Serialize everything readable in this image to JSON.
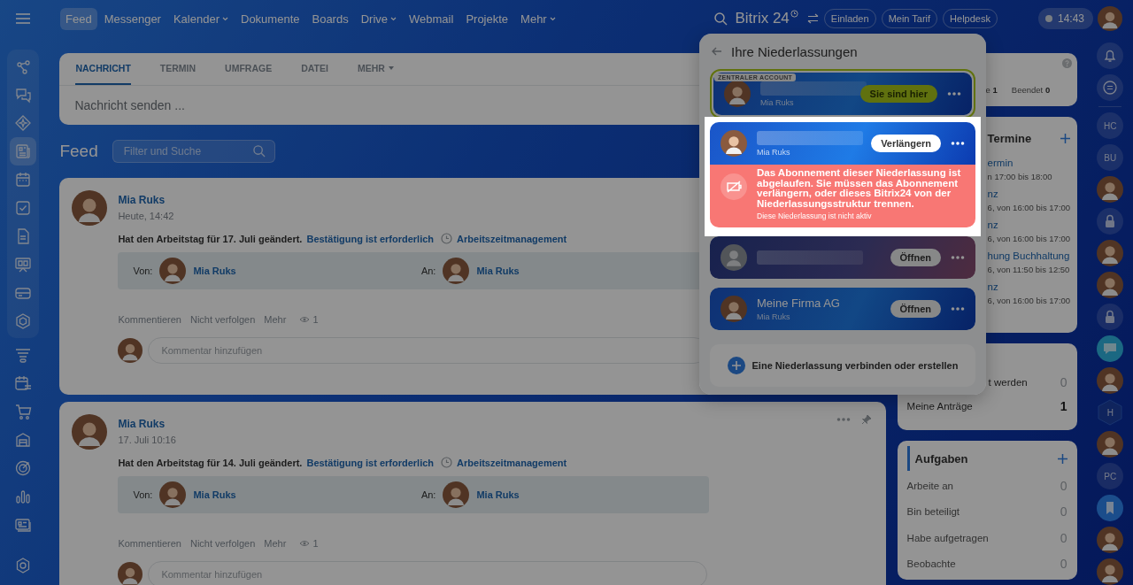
{
  "topbar": {
    "nav": [
      {
        "label": "Feed",
        "selected": true,
        "dropdown": false
      },
      {
        "label": "Messenger",
        "selected": false,
        "dropdown": false
      },
      {
        "label": "Kalender",
        "selected": false,
        "dropdown": true
      },
      {
        "label": "Dokumente",
        "selected": false,
        "dropdown": false
      },
      {
        "label": "Boards",
        "selected": false,
        "dropdown": false
      },
      {
        "label": "Drive",
        "selected": false,
        "dropdown": true
      },
      {
        "label": "Webmail",
        "selected": false,
        "dropdown": false
      },
      {
        "label": "Projekte",
        "selected": false,
        "dropdown": false
      },
      {
        "label": "Mehr",
        "selected": false,
        "dropdown": true
      }
    ],
    "logo": "Bitrix 24",
    "buttons": [
      "Einladen",
      "Mein Tarif",
      "Helpdesk"
    ],
    "time": "14:43"
  },
  "sidebar": {
    "items": [
      {
        "selected": false
      },
      {
        "selected": false
      },
      {
        "selected": false
      },
      {
        "selected": true
      },
      {
        "selected": false
      },
      {
        "selected": false
      },
      {
        "selected": false
      },
      {
        "selected": false
      },
      {
        "selected": false
      },
      {
        "selected": false
      },
      {
        "selected": false
      },
      {
        "selected": false
      },
      {
        "selected": false
      },
      {
        "selected": false
      },
      {
        "selected": false
      },
      {
        "selected": false
      },
      {
        "selected": false
      }
    ]
  },
  "composer": {
    "tabs": [
      {
        "label": "NACHRICHT",
        "selected": true,
        "dropdown": false
      },
      {
        "label": "TERMIN",
        "selected": false,
        "dropdown": false
      },
      {
        "label": "UMFRAGE",
        "selected": false,
        "dropdown": false
      },
      {
        "label": "DATEI",
        "selected": false,
        "dropdown": false
      },
      {
        "label": "MEHR",
        "selected": false,
        "dropdown": true
      }
    ],
    "placeholder": "Nachricht senden ..."
  },
  "feed": {
    "title": "Feed",
    "search_placeholder": "Filter und Suche",
    "posts": [
      {
        "author": "Mia Ruks",
        "time": "Heute, 14:42",
        "text": "Hat den Arbeitstag für 17. Juli geändert.",
        "status_link": "Bestätigung ist erforderlich",
        "module_link": "Arbeitszeitmanagement",
        "from_label": "Von:",
        "from": "Mia Ruks",
        "to_label": "An:",
        "to": "Mia Ruks",
        "actions": [
          "Kommentieren",
          "Nicht verfolgen",
          "Mehr"
        ],
        "views": "1",
        "comment_placeholder": "Kommentar hinzufügen"
      },
      {
        "author": "Mia Ruks",
        "time": "17. Juli 10:16",
        "text": "Hat den Arbeitstag für 14. Juli geändert.",
        "status_link": "Bestätigung ist erforderlich",
        "module_link": "Arbeitszeitmanagement",
        "from_label": "Von:",
        "from": "Mia Ruks",
        "to_label": "An:",
        "to": "Mia Ruks",
        "actions": [
          "Kommentieren",
          "Nicht verfolgen",
          "Mehr"
        ],
        "views": "1",
        "comment_placeholder": "Kommentar hinzufügen",
        "menu_visible": true
      }
    ]
  },
  "popup": {
    "title": "Ihre Niederlassungen",
    "accounts": [
      {
        "kind": "central",
        "badge": "ZENTRALER ACCOUNT",
        "owner": "Mia Ruks",
        "button": "Sie sind hier",
        "highlighted": false
      },
      {
        "kind": "expired",
        "owner": "Mia Ruks",
        "button": "Verlängern",
        "highlighted": true,
        "message": "Das Abonnement dieser Niederlassung ist abgelaufen. Sie müssen das Abonnement verlängern, oder dieses Bitrix24 von der Niederlassungsstruktur trennen.",
        "note": "Diese Niederlassung ist nicht aktiv"
      },
      {
        "kind": "inactive",
        "button": "Öffnen",
        "highlighted": false
      },
      {
        "kind": "open",
        "name": "Meine Firma AG",
        "owner": "Mia Ruks",
        "button": "Öffnen",
        "highlighted": false
      }
    ],
    "footer": "Eine Niederlassung verbinden oder erstellen"
  },
  "right": {
    "stats": [
      {
        "label": "e",
        "count": "1"
      },
      {
        "label": "Beendet",
        "count": "0"
      }
    ],
    "events": {
      "title": "Termine",
      "items": [
        {
          "title": "ermin",
          "time": "n 17:00 bis 18:00"
        },
        {
          "title": "nz",
          "time": "6, von 16:00 bis 17:00"
        },
        {
          "title": "nz",
          "time": "6, von 16:00 bis 17:00"
        },
        {
          "title": "hung Buchhaltung",
          "time": "6, von 11:50 bis 12:50"
        },
        {
          "title": "nz",
          "time": "6, von 16:00 bis 17:00"
        }
      ]
    },
    "requests": [
      {
        "kind": "clipped",
        "label": "t werden",
        "count": "0",
        "emphasis": false
      },
      {
        "kind": "row",
        "label": "Meine Anträge",
        "count": "1",
        "emphasis": true
      }
    ],
    "tasks": {
      "title": "Aufgaben",
      "items": [
        {
          "label": "Arbeite an",
          "count": "0"
        },
        {
          "label": "Bin beteiligt",
          "count": "0"
        },
        {
          "label": "Habe aufgetragen",
          "count": "0"
        },
        {
          "label": "Beobachte",
          "count": "0"
        }
      ]
    }
  },
  "rail": {
    "items": [
      {
        "kind": "initials",
        "label": "HC"
      },
      {
        "kind": "initials",
        "label": "BU"
      },
      {
        "kind": "photo"
      },
      {
        "kind": "lock"
      },
      {
        "kind": "photo"
      },
      {
        "kind": "photo"
      },
      {
        "kind": "lock"
      },
      {
        "kind": "chat"
      },
      {
        "kind": "photo"
      },
      {
        "kind": "hex",
        "label": "H"
      },
      {
        "kind": "photo"
      },
      {
        "kind": "initials",
        "label": "PC"
      },
      {
        "kind": "bookmark"
      },
      {
        "kind": "photo"
      },
      {
        "kind": "photo"
      }
    ]
  }
}
